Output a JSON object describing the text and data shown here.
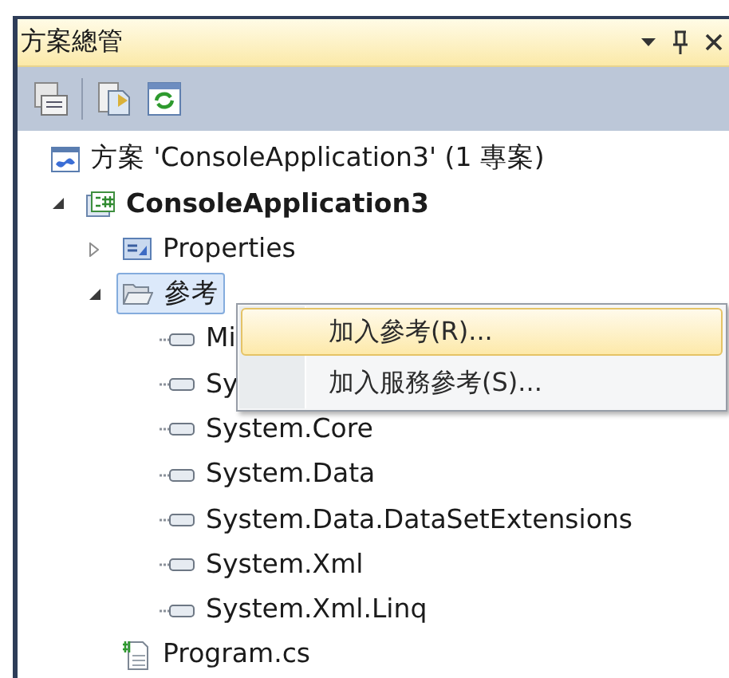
{
  "panel": {
    "title": "方案總管"
  },
  "tree": [
    {
      "label": "方案 'ConsoleApplication3' (1 專案)",
      "kind": "solution",
      "selected": false,
      "children": [
        {
          "label": "ConsoleApplication3",
          "kind": "project",
          "expanded": true,
          "selected": false,
          "children": [
            {
              "label": "Properties",
              "kind": "properties",
              "expanded": false,
              "selected": false
            },
            {
              "label": "參考",
              "kind": "folder",
              "expanded": true,
              "selected": true,
              "children": [
                {
                  "label": "Mi",
                  "kind": "reference",
                  "selected": false
                },
                {
                  "label": "Sy",
                  "kind": "reference",
                  "selected": false
                },
                {
                  "label": "System.Core",
                  "kind": "reference",
                  "selected": false
                },
                {
                  "label": "System.Data",
                  "kind": "reference",
                  "selected": false
                },
                {
                  "label": "System.Data.DataSetExtensions",
                  "kind": "reference",
                  "selected": false
                },
                {
                  "label": "System.Xml",
                  "kind": "reference",
                  "selected": false
                },
                {
                  "label": "System.Xml.Linq",
                  "kind": "reference",
                  "selected": false
                }
              ]
            },
            {
              "label": "Program.cs",
              "kind": "file",
              "selected": false
            }
          ]
        }
      ]
    }
  ],
  "context_menu": [
    {
      "label": "加入參考(R)...",
      "selected": true
    },
    {
      "label": "加入服務參考(S)...",
      "selected": false
    }
  ]
}
